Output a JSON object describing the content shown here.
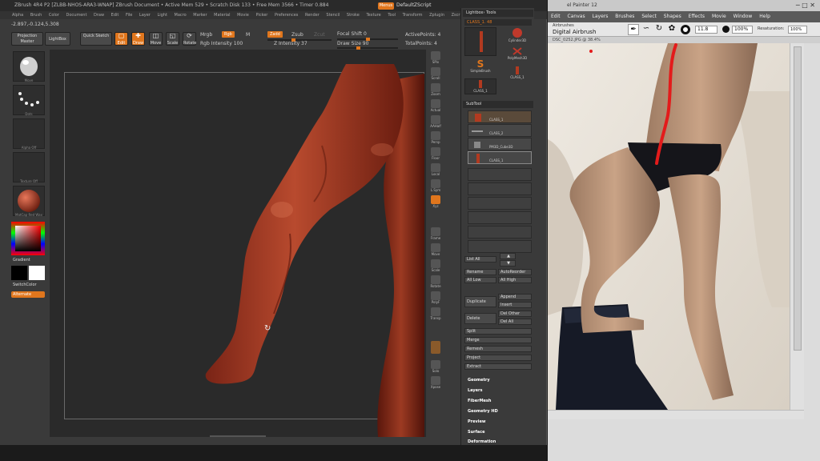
{
  "zbrush": {
    "title": "ZBrush 4R4 P2 [ZLBB-NHOS-ARA3-WNAP]   ZBrush Document   • Active Mem 529 • Scratch Disk 133 • Free Mem 3566 • Timer 0.884",
    "menu_button": "Menus",
    "script_label": "DefaultZScript",
    "menus": [
      "Alpha",
      "Brush",
      "Color",
      "Document",
      "Draw",
      "Edit",
      "File",
      "Layer",
      "Light",
      "Macro",
      "Marker",
      "Material",
      "Movie",
      "Picker",
      "Preferences",
      "Render",
      "Stencil",
      "Stroke",
      "Texture",
      "Tool",
      "Transform",
      "Zplugin",
      "Zscript"
    ],
    "coords": "-2.897,-0.124,5.308",
    "toolbar": {
      "projection_master": "Projection Master",
      "lightbox": "LightBox",
      "quick_sketch": "Quick Sketch",
      "edit": "Edit",
      "draw": "Draw",
      "move": "Move",
      "scale": "Scale",
      "rotate": "Rotate",
      "mrgb": "Mrgb",
      "rgb": "Rgb",
      "m": "M",
      "rgb_intensity": "Rgb Intensity 100",
      "zadd": "Zadd",
      "zsub": "Zsub",
      "zcut": "Zcut",
      "z_intensity": "Z Intensity 37",
      "focal_shift": "Focal Shift 0",
      "draw_size": "Draw Size 90",
      "active_points": "ActivePoints: 4",
      "total_points": "TotalPoints: 4"
    },
    "left_shelf": {
      "brush_label": "Move",
      "stroke_label": "Dots",
      "alpha_label": "Alpha Off",
      "texture_label": "Texture Off",
      "material_label": "MatCap Red Wax",
      "gradient_label": "Gradient",
      "switch_color_label": "SwitchColor",
      "alternate_label": "Alternate"
    },
    "right_shelf": [
      "SPix",
      "Scroll",
      "Zoom",
      "Actual",
      "AAHalf",
      "Persp",
      "Floor",
      "Local",
      "L.Sym",
      "Xyz",
      "",
      "Frame",
      "Move",
      "Scale",
      "Rotate",
      "PolyF",
      "Transp",
      "",
      "Solo",
      "Xpose"
    ],
    "tool_panel": {
      "header": "Lightbox› Tools",
      "current_tool": "CLASS_1. 48",
      "tools": [
        "CLASS_1",
        "Cylinder3D",
        "PolyMesh3D",
        "SimpleBrush",
        "CLASS_1",
        "CLASS_1"
      ],
      "subtool_header": "SubTool",
      "subtools": [
        "CLASS_1",
        "CLASS_2",
        "PM3D_Cube3D",
        "CLASS_1"
      ],
      "list_all": "List All",
      "rename": "Rename",
      "auto_reorder": "AutoReorder",
      "all_low": "All Low",
      "all_high": "All High",
      "duplicate": "Duplicate",
      "append": "Append",
      "insert": "Insert",
      "delete": "Delete",
      "del_other": "Del Other",
      "del_all": "Del All",
      "split": "Split",
      "merge": "Merge",
      "remesh": "Remesh",
      "project": "Project",
      "extract": "Extract",
      "sections": [
        "Geometry",
        "Layers",
        "FiberMesh",
        "Geometry HD",
        "Preview",
        "Surface",
        "Deformation"
      ]
    }
  },
  "painter": {
    "title": "el Painter 12",
    "menus": [
      "Edit",
      "Canvas",
      "Layers",
      "Brushes",
      "Select",
      "Shapes",
      "Effects",
      "Movie",
      "Window",
      "Help"
    ],
    "brush_category": "Airbrushes",
    "brush_variant": "Digital Airbrush",
    "size": "11.8",
    "opacity": "100%",
    "resaturation_label": "Resaturation:",
    "resaturation": "100%",
    "document": "DSC_0252.JPG @ 38.4%"
  },
  "colors": {
    "zbrush_accent": "#e0761d",
    "clay": "#a23d25",
    "painter_stroke": "#e31b1b"
  }
}
